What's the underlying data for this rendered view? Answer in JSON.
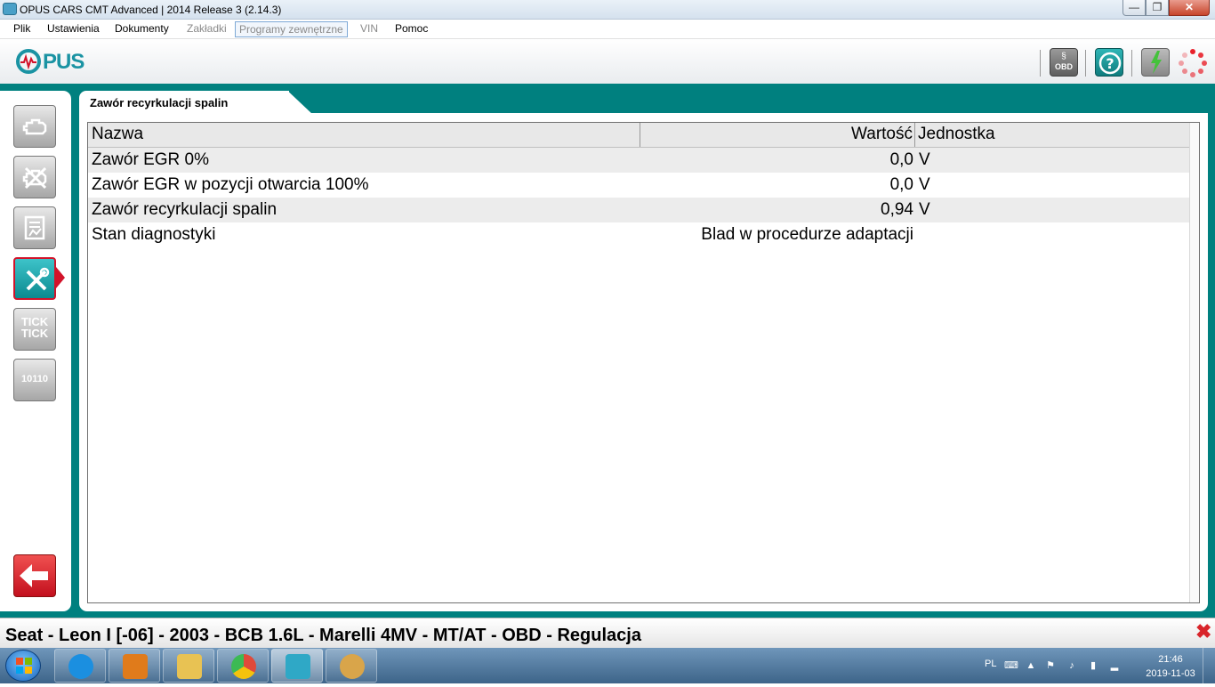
{
  "window": {
    "title": "OPUS CARS CMT Advanced | 2014 Release 3 (2.14.3)",
    "min_glyph": "—",
    "max_glyph": "❐",
    "close_glyph": "✕"
  },
  "menu": {
    "items": [
      {
        "label": "Plik"
      },
      {
        "label": "Ustawienia"
      },
      {
        "label": "Dokumenty"
      },
      {
        "label": "Zakładki"
      },
      {
        "label": "Programy zewnętrzne"
      },
      {
        "label": "VIN"
      },
      {
        "label": "Pomoc"
      }
    ]
  },
  "header": {
    "logo_text": "PUS",
    "icons": [
      "obd-icon",
      "help-icon",
      "battery-icon",
      "loading-spinner-icon"
    ],
    "obd_label": "OBD",
    "obd_symbol": "§"
  },
  "sidebar": {
    "buttons": [
      {
        "name": "engine-icon"
      },
      {
        "name": "clear-errors-icon"
      },
      {
        "name": "live-data-icon"
      },
      {
        "name": "service-tools-icon"
      },
      {
        "name": "tick-icon",
        "label_top": "TICK",
        "label_bottom": "TICK"
      },
      {
        "name": "coding-icon",
        "label": "10110"
      }
    ],
    "back_icon": "back-arrow-icon"
  },
  "tab": {
    "label": "Zawór recyrkulacji spalin"
  },
  "table": {
    "columns": [
      "Nazwa",
      "Wartość",
      "Jednostka"
    ],
    "rows": [
      {
        "name": "Zawór EGR 0%",
        "value": "0,0",
        "unit": "V"
      },
      {
        "name": "Zawór EGR w pozycji otwarcia 100%",
        "value": "0,0",
        "unit": "V"
      },
      {
        "name": "Zawór recyrkulacji spalin",
        "value": "0,94",
        "unit": "V"
      },
      {
        "name": "Stan diagnostyki",
        "value": "Blad w procedurze adaptacji",
        "unit": ""
      }
    ]
  },
  "status": {
    "text": "Seat - Leon I [-06] - 2003 - BCB 1.6L - Marelli 4MV - MT/AT - OBD - Regulacja",
    "close_glyph": "✖"
  },
  "taskbar": {
    "apps": [
      {
        "name": "internet-explorer-icon",
        "color": "#1b8fe0"
      },
      {
        "name": "media-player-icon",
        "color": "#e07b1b"
      },
      {
        "name": "file-explorer-icon",
        "color": "#e8c253"
      },
      {
        "name": "chrome-icon",
        "color": "#e04a3a"
      },
      {
        "name": "opus-cars-icon",
        "color": "#2fa8c6"
      },
      {
        "name": "paint-icon",
        "color": "#d9a54a"
      }
    ],
    "language": "PL",
    "time": "21:46",
    "date": "2019-11-03"
  }
}
